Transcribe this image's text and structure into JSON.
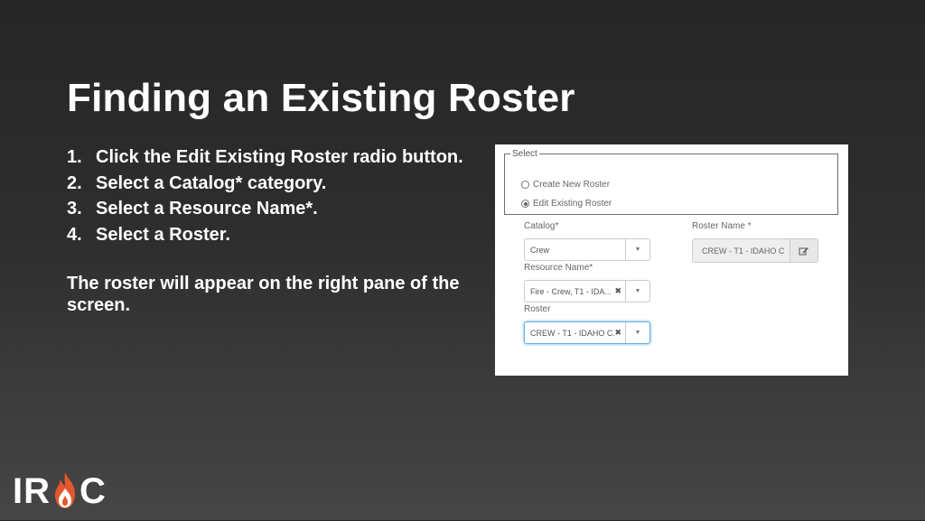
{
  "slide": {
    "title": "Finding an Existing Roster",
    "steps": [
      {
        "num": "1.",
        "text": "Click the Edit Existing Roster radio button."
      },
      {
        "num": "2.",
        "text": "Select a Catalog* category."
      },
      {
        "num": "3.",
        "text": "Select a Resource Name*."
      },
      {
        "num": "4.",
        "text": "Select a Roster."
      }
    ],
    "note": "The roster will appear on the right pane of the screen."
  },
  "form": {
    "legend": "Select",
    "radios": [
      {
        "label": "Create New Roster",
        "checked": false
      },
      {
        "label": "Edit Existing Roster",
        "checked": true
      }
    ],
    "catalog": {
      "label": "Catalog",
      "required_mark": "*",
      "value": "Crew"
    },
    "resource_name": {
      "label": "Resource Name",
      "required_mark": "*",
      "value": "Fire - Crew, T1 - IDA...",
      "clear": "✖"
    },
    "roster": {
      "label": "Roster",
      "value": "CREW - T1 - IDAHO C...",
      "clear": "✖"
    },
    "roster_name": {
      "label": "Roster Name",
      "required_mark": "*",
      "value": "CREW - T1 - IDAHO C"
    },
    "edit_icon": "edit-pencil-icon",
    "dropdown_icon": "caret-down-icon"
  },
  "logo": {
    "text_left": "IR",
    "text_right": "C"
  },
  "colors": {
    "focus_border": "#66afe9",
    "flame_orange": "#e4572e"
  }
}
